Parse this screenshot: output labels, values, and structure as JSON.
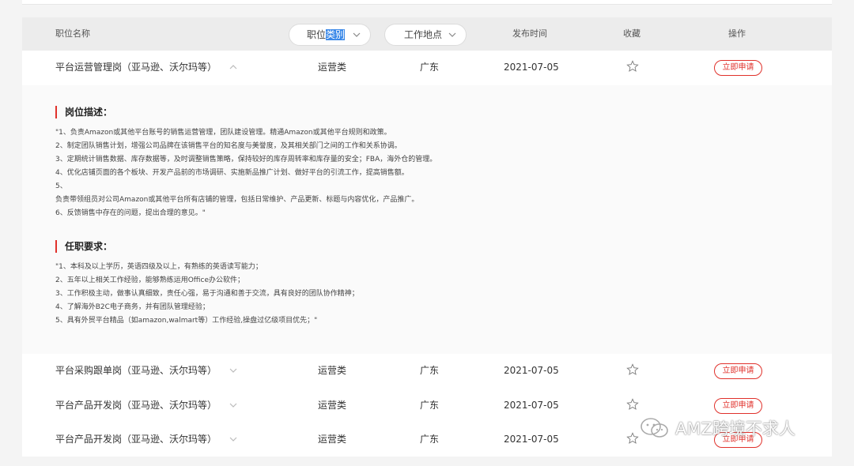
{
  "header": {
    "title_col": "职位名称",
    "category_filter": {
      "before": "职位",
      "highlight": "类别"
    },
    "location_filter": "工作地点",
    "date_col": "发布时间",
    "favorite_col": "收藏",
    "action_col": "操作"
  },
  "jobs": [
    {
      "title": "平台运营管理岗（亚马逊、沃尔玛等）",
      "category": "运营类",
      "location": "广东",
      "date": "2021-07-05",
      "apply_label": "立即申请",
      "expanded": true
    },
    {
      "title": "平台采购跟单岗（亚马逊、沃尔玛等）",
      "category": "运营类",
      "location": "广东",
      "date": "2021-07-05",
      "apply_label": "立即申请",
      "expanded": false
    },
    {
      "title": "平台产品开发岗（亚马逊、沃尔玛等）",
      "category": "运营类",
      "location": "广东",
      "date": "2021-07-05",
      "apply_label": "立即申请",
      "expanded": false
    },
    {
      "title": "平台产品开发岗（亚马逊、沃尔玛等）",
      "category": "运营类",
      "location": "广东",
      "date": "2021-07-05",
      "apply_label": "立即申请",
      "expanded": false
    }
  ],
  "detail": {
    "desc_title": "岗位描述：",
    "desc_lines": [
      "\"1、负责Amazon或其他平台账号的销售运营管理，团队建设管理。精通Amazon或其他平台规则和政策。",
      "2、制定团队销售计划，增强公司品牌在该销售平台的知名度与美誉度，及其相关部门之间的工作和关系协调。",
      "3、定期统计销售数据、库存数据等，及时调整销售策略，保持较好的库存周转率和库存量的安全；FBA，海外仓的管理。",
      "4、优化店铺页面的各个板块、开发产品前的市场调研、实施新品推广计划、做好平台的引流工作，提高销售额。",
      "5、",
      "负责带领组员对公司Amazon或其他平台所有店铺的管理，包括日常维护、产品更新、标题与内容优化，产品推广。",
      "6、反馈销售中存在的问题，提出合理的意见。\""
    ],
    "req_title": "任职要求：",
    "req_lines": [
      "\"1、本科及以上学历，英语四级及以上，有熟练的英语读写能力；",
      "2、五年以上相关工作经验，能够熟练运用Office办公软件；",
      "3、工作积极主动，做事认真细致，责任心强，易于沟通和善于交流，具有良好的团队协作精神；",
      "4、了解海外B2C电子商务，并有团队管理经验；",
      "5、具有外贸平台精品（如amazon,walmart等）工作经验,操盘过亿级项目优先；\""
    ]
  },
  "watermark": "AMZ跨境不求人",
  "colors": {
    "accent": "#e0312b",
    "header_bg": "#ececec",
    "highlight": "#3b89e8"
  }
}
